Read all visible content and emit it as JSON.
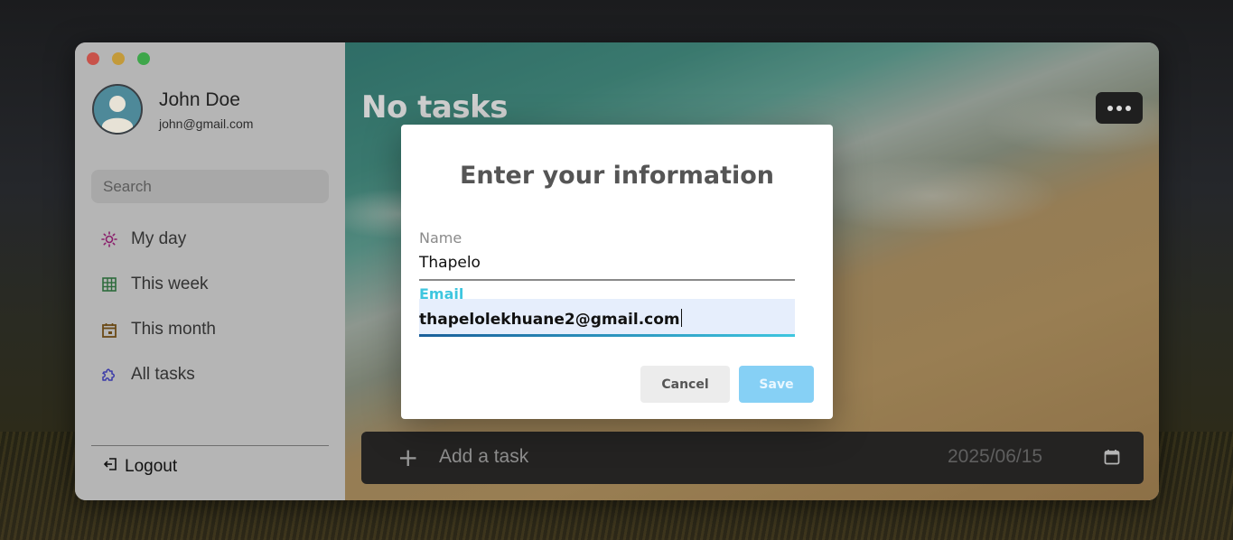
{
  "window": {
    "traffic_lights": [
      "#e0564f",
      "#dda43f",
      "#3fbf4d"
    ]
  },
  "sidebar": {
    "profile": {
      "name": "John Doe",
      "email": "john@gmail.com",
      "avatar_icon": "user-avatar-icon"
    },
    "search": {
      "placeholder": "Search"
    },
    "items": [
      {
        "label": "My day",
        "icon": "sun-icon",
        "color": "#8a1e6b"
      },
      {
        "label": "This week",
        "icon": "grid-calendar-icon",
        "color": "#2d6b3c"
      },
      {
        "label": "This month",
        "icon": "calendar-icon",
        "color": "#6b4a16"
      },
      {
        "label": "All tasks",
        "icon": "puzzle-icon",
        "color": "#3a3aa8"
      }
    ],
    "logout_label": "Logout"
  },
  "main": {
    "title": "No tasks",
    "more_button_icon": "more-dots-icon",
    "add_task": {
      "plus": "+",
      "placeholder": "Add a task",
      "date": "2025/06/15",
      "calendar_icon": "calendar-icon"
    }
  },
  "modal": {
    "title": "Enter your information",
    "name_label": "Name",
    "name_value": "Thapelo",
    "email_label": "Email",
    "email_value": "thapelolekhuane2@gmail.com",
    "cancel_label": "Cancel",
    "save_label": "Save",
    "accent": "#3ec6df"
  }
}
